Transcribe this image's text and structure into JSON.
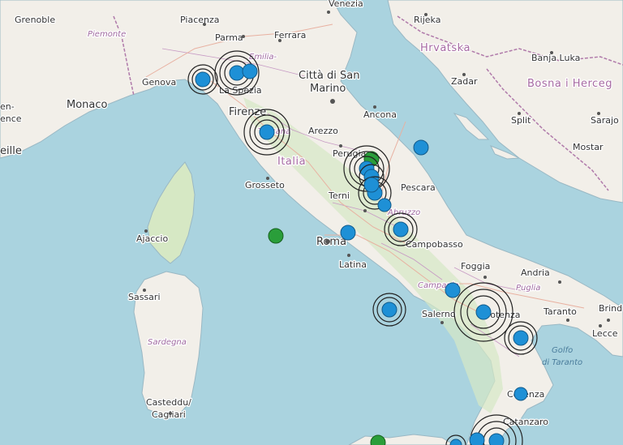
{
  "map": {
    "colors": {
      "sea": "#aad3df",
      "land": "#f2efe9",
      "green_land": "#d6e8c4",
      "border": "#b07aaa",
      "road": "#e8b0a0",
      "quake_blue": "#1e90d6",
      "quake_green": "#2a9e3a",
      "ring": "#222222"
    },
    "labels": {
      "venezia": "Venezia",
      "grenoble": "Grenoble",
      "piacenza": "Piacenza",
      "piemonte": "Piemonte",
      "parma": "Parma",
      "ferrara": "Ferrara",
      "emilia": "Emilia-",
      "rijeka": "Rijeka",
      "hrvatska": "Hrvatska",
      "banja_luka": "Banja Luka",
      "genova": "Genova",
      "la_spezia": "La Spezia",
      "citta_di_san_marino_1": "Città di San",
      "citta_di_san_marino_2": "Marino",
      "zadar": "Zadar",
      "bosna": "Bosna i Herceg",
      "monaco": "Monaco",
      "en": "en-",
      "ence": "ence",
      "firenze": "Firenze",
      "toscana": "Toscana",
      "ancona": "Ancona",
      "split": "Split",
      "saraj": "Sarajo",
      "arezzo": "Arezzo",
      "eille": "eille",
      "perugia": "Perugia",
      "mostar": "Mostar",
      "italia": "Italia",
      "grosseto": "Grosseto",
      "pescara": "Pescara",
      "terni": "Terni",
      "abruzzo": "Abruzzo",
      "ajaccio": "Ajaccio",
      "roma": "Roma",
      "campobasso": "Campobasso",
      "latina": "Latina",
      "foggia": "Foggia",
      "andria": "Andria",
      "sassari": "Sassari",
      "campania": "Campania",
      "puglia": "Puglia",
      "taranto": "Taranto",
      "brindisi": "Brind",
      "salerno": "Salerno",
      "potenza": "Potenza",
      "lecce": "Lecce",
      "sardegna": "Sardegna",
      "golfo_1": "Golfo",
      "golfo_2": "di Taranto",
      "cosenza": "Cosenza",
      "cagliari_1": "Casteddu/",
      "cagliari_2": "Cagliari",
      "catanzaro": "Catanzaro"
    },
    "earthquakes": [
      {
        "id": "genova",
        "color": "blue",
        "rings": 2
      },
      {
        "id": "parma-1",
        "color": "blue",
        "rings": 3
      },
      {
        "id": "parma-2",
        "color": "blue",
        "rings": 0
      },
      {
        "id": "firenze",
        "color": "blue",
        "rings": 3
      },
      {
        "id": "adriatic",
        "color": "blue",
        "rings": 0
      },
      {
        "id": "perugia-green",
        "color": "green",
        "rings": 0
      },
      {
        "id": "perugia-1",
        "color": "blue",
        "rings": 3
      },
      {
        "id": "perugia-2",
        "color": "blue",
        "rings": 2
      },
      {
        "id": "perugia-3",
        "color": "blue",
        "rings": 2
      },
      {
        "id": "perugia-4",
        "color": "blue",
        "rings": 0
      },
      {
        "id": "pescara-south",
        "color": "blue",
        "rings": 0
      },
      {
        "id": "tyrrhenian-green",
        "color": "green",
        "rings": 0
      },
      {
        "id": "roma",
        "color": "blue",
        "rings": 0
      },
      {
        "id": "campobasso",
        "color": "blue",
        "rings": 3
      },
      {
        "id": "campania",
        "color": "blue",
        "rings": 0
      },
      {
        "id": "potenza",
        "color": "blue",
        "rings": 3
      },
      {
        "id": "salerno-sea",
        "color": "blue",
        "rings": 2
      },
      {
        "id": "taranto-gulf",
        "color": "blue",
        "rings": 2
      },
      {
        "id": "cosenza",
        "color": "blue",
        "rings": 0
      },
      {
        "id": "calabria-1",
        "color": "blue",
        "rings": 3
      },
      {
        "id": "calabria-2",
        "color": "blue",
        "rings": 0
      },
      {
        "id": "sicily-green",
        "color": "green",
        "rings": 0
      },
      {
        "id": "bottom",
        "color": "blue",
        "rings": 1
      }
    ]
  }
}
